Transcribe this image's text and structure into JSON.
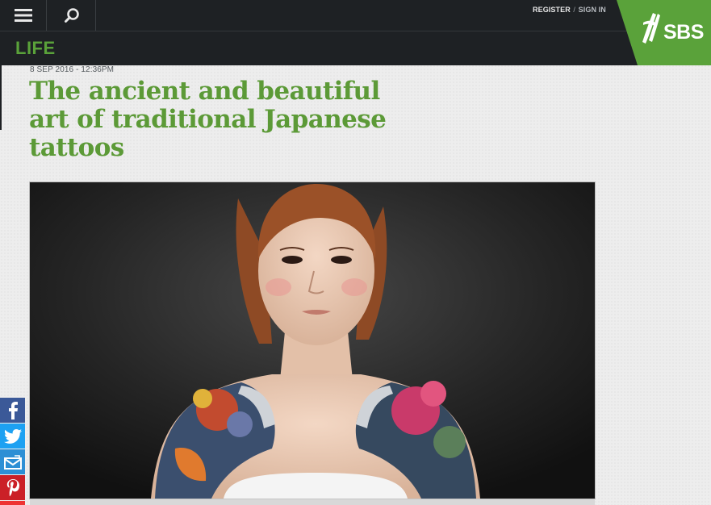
{
  "header": {
    "menu_icon": "hamburger-menu-icon",
    "search_icon": "search-icon",
    "register_label": "REGISTER",
    "separator": "/",
    "signin_label": "SIGN IN"
  },
  "logo": {
    "text": "SBS",
    "brand_color": "#5aa23a"
  },
  "section": {
    "title": "LIFE",
    "color": "#5aa23a"
  },
  "article": {
    "date": "8 SEP 2016 - 12:36PM",
    "headline": "The ancient and beautiful art of traditional Japanese tattoos",
    "headline_color": "#5c9a37",
    "image_subject": "woman-with-japanese-tattoos-photo"
  },
  "share": {
    "items": [
      {
        "name": "facebook",
        "icon": "facebook-icon",
        "color": "#3b5998"
      },
      {
        "name": "twitter",
        "icon": "twitter-icon",
        "color": "#1da1f2"
      },
      {
        "name": "email",
        "icon": "email-icon",
        "color": "#2d8fd5"
      },
      {
        "name": "pinterest",
        "icon": "pinterest-icon",
        "color": "#cb2027"
      }
    ]
  }
}
